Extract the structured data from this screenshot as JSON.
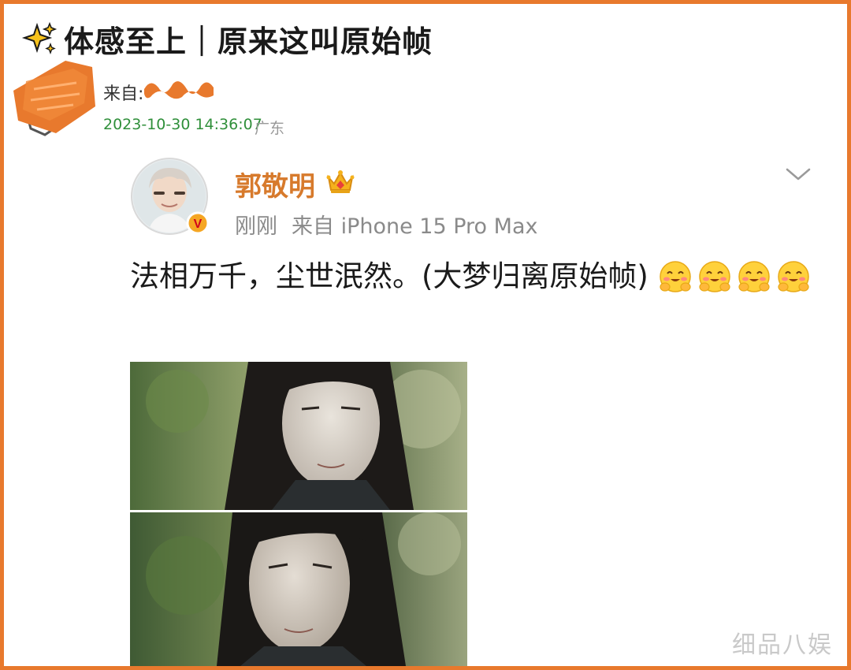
{
  "header": {
    "title": "体感至上｜原来这叫原始帧",
    "title_icon": "sparkles-icon"
  },
  "poster": {
    "from_label": "来自:",
    "timestamp": "2023-10-30 14:36:07",
    "location": "广东"
  },
  "weibo": {
    "author_name": "郭敬明",
    "badge": "crown-icon",
    "time_label": "刚刚",
    "source_label": "来自 iPhone 15 Pro Max",
    "text": "法相万千，尘世泯然。(大梦归离原始帧)",
    "emoji_count": 4,
    "emoji_name": "blush-hug-emoji"
  },
  "watermark": {
    "text": "细品八娱"
  },
  "colors": {
    "frame_border": "#e8792d",
    "author_name": "#d77a2c",
    "timestamp": "#2f8f3a",
    "meta_text": "#8a8a8a"
  }
}
